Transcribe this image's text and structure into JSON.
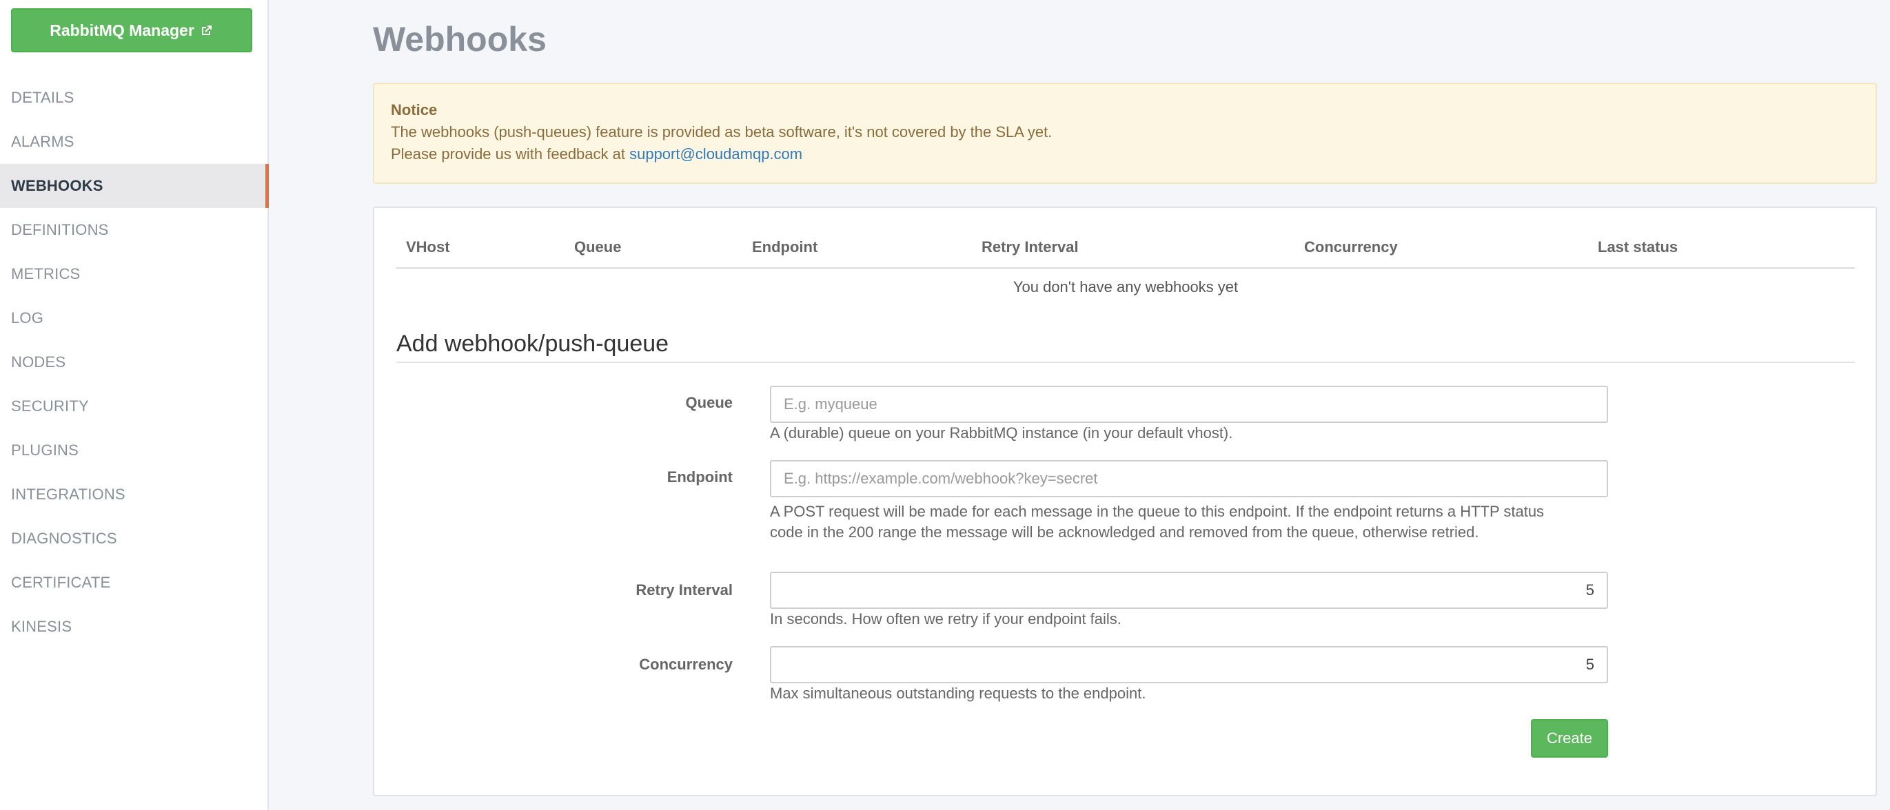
{
  "sidebar": {
    "manager_button": "RabbitMQ Manager",
    "items": [
      {
        "label": "DETAILS",
        "active": false
      },
      {
        "label": "ALARMS",
        "active": false
      },
      {
        "label": "WEBHOOKS",
        "active": true
      },
      {
        "label": "DEFINITIONS",
        "active": false
      },
      {
        "label": "METRICS",
        "active": false
      },
      {
        "label": "LOG",
        "active": false
      },
      {
        "label": "NODES",
        "active": false
      },
      {
        "label": "SECURITY",
        "active": false
      },
      {
        "label": "PLUGINS",
        "active": false
      },
      {
        "label": "INTEGRATIONS",
        "active": false
      },
      {
        "label": "DIAGNOSTICS",
        "active": false
      },
      {
        "label": "CERTIFICATE",
        "active": false
      },
      {
        "label": "KINESIS",
        "active": false
      }
    ]
  },
  "page": {
    "title": "Webhooks"
  },
  "notice": {
    "title": "Notice",
    "line1": "The webhooks (push-queues) feature is provided as beta software, it's not covered by the SLA yet.",
    "line2_prefix": "Please provide us with feedback at ",
    "email": "support@cloudamqp.com"
  },
  "table": {
    "columns": [
      "VHost",
      "Queue",
      "Endpoint",
      "Retry Interval",
      "Concurrency",
      "Last status"
    ],
    "empty_message": "You don't have any webhooks yet"
  },
  "form": {
    "title": "Add webhook/push-queue",
    "queue": {
      "label": "Queue",
      "placeholder": "E.g. myqueue",
      "value": "",
      "help": "A (durable) queue on your RabbitMQ instance (in your default vhost)."
    },
    "endpoint": {
      "label": "Endpoint",
      "placeholder": "E.g. https://example.com/webhook?key=secret",
      "value": "",
      "help_line1": "A POST request will be made for each message in the queue to this endpoint. If the endpoint returns a HTTP status",
      "help_line2": "code in the 200 range the message will be acknowledged and removed from the queue, otherwise retried."
    },
    "retry_interval": {
      "label": "Retry Interval",
      "value": "5",
      "help": "In seconds. How often we retry if your endpoint fails."
    },
    "concurrency": {
      "label": "Concurrency",
      "value": "5",
      "help": "Max simultaneous outstanding requests to the endpoint."
    },
    "submit_label": "Create"
  },
  "colors": {
    "accent_green": "#5cb85c",
    "active_marker": "#e8703a",
    "notice_bg": "#fcf6e3",
    "link": "#337ab7"
  }
}
